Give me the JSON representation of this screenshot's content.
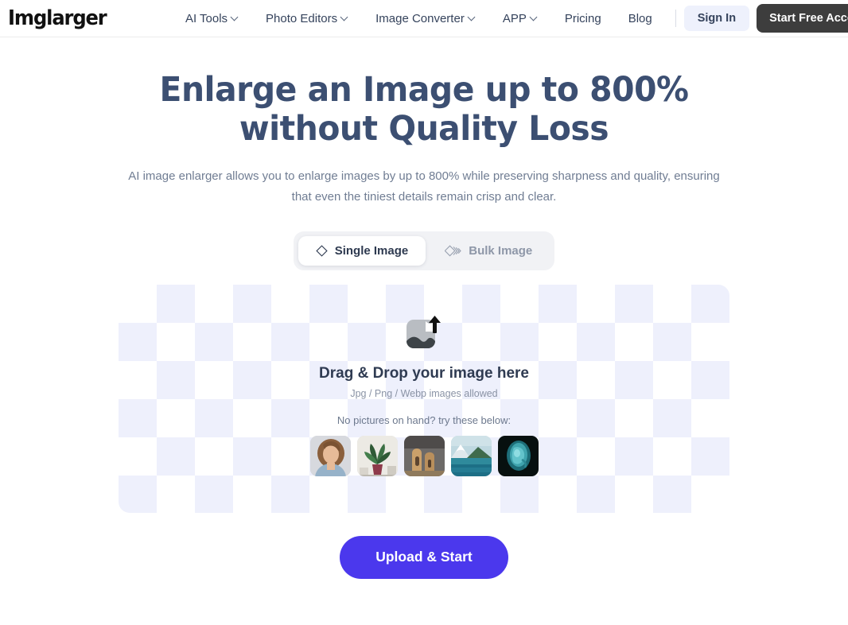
{
  "header": {
    "logo": "Imglarger",
    "nav": [
      {
        "label": "AI Tools",
        "has_dropdown": true
      },
      {
        "label": "Photo Editors",
        "has_dropdown": true
      },
      {
        "label": "Image Converter",
        "has_dropdown": true
      },
      {
        "label": "APP",
        "has_dropdown": true
      },
      {
        "label": "Pricing",
        "has_dropdown": false
      },
      {
        "label": "Blog",
        "has_dropdown": false
      }
    ],
    "sign_in_label": "Sign In",
    "start_free_label": "Start Free Account"
  },
  "hero": {
    "title_line1": "Enlarge an Image up to 800%",
    "title_line2": "without Quality Loss",
    "subtitle_line1": "AI image enlarger allows you to enlarge images by up to 800% while preserving sharpness and quality,",
    "subtitle_line2": "ensuring that even the tiniest details remain crisp and clear."
  },
  "tabs": [
    {
      "label": "Single Image",
      "icon": "diamond-icon",
      "active": true
    },
    {
      "label": "Bulk Image",
      "icon": "stacked-diamonds-icon",
      "active": false
    }
  ],
  "dropzone": {
    "icon": "image-upload-icon",
    "title": "Drag & Drop your image here",
    "formats": "Jpg / Png / Webp images allowed",
    "samples_hint": "No pictures on hand? try these below:",
    "samples": [
      {
        "name": "portrait-woman-curly-hair"
      },
      {
        "name": "houseplants-on-shelf"
      },
      {
        "name": "sandstone-architecture"
      },
      {
        "name": "snow-mountain-lake"
      },
      {
        "name": "teal-sculpture-dark"
      }
    ]
  },
  "cta": {
    "upload_label": "Upload & Start"
  },
  "colors": {
    "accent_button": "#4b38ed",
    "heading": "#3c4f72",
    "dark_button": "#3d3d3d",
    "signin_bg": "#eef1fc",
    "checker": "#eef0fc"
  }
}
